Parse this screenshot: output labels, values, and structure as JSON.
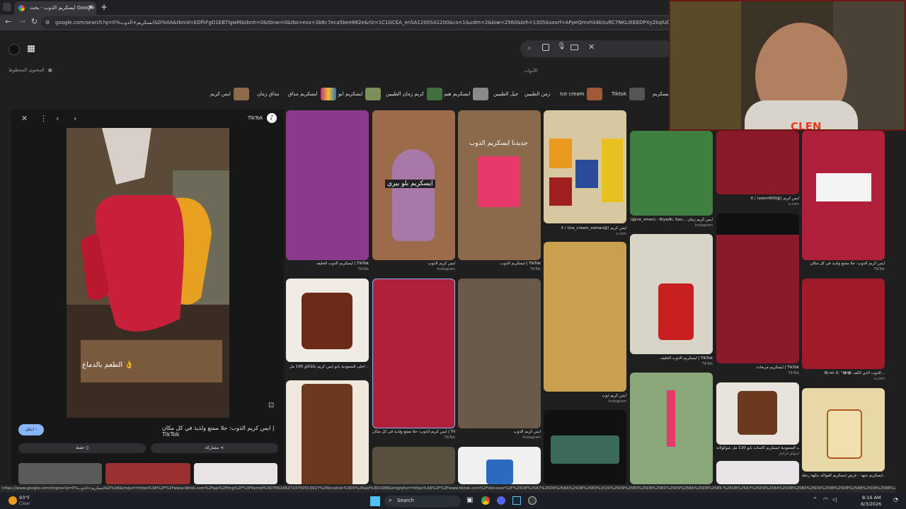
{
  "browser": {
    "tab_title": "ايسكريم الذوب - بحث Google",
    "new_tab": "+",
    "url": "google.com/search?q=0%ايسكريم+الذوب&D%0A&tbnid=EDfhFgD1EBTlgwM&tbnh=0&tbnw=0&tbs=esv=3b8c7eca5bee662e&rlz=1C1GCEA_enSA1200SA1200&cs=1&udm=2&biw=2560&bih=1305&sxsrf=APpeQmvhS4bSuRC7NKL0tEEDPXy2kqIUOA%3A1785708681796&ei=icBvatO"
  },
  "google": {
    "safe_search": "المحتوى المحظوظ",
    "tools": "الأدوات"
  },
  "chips": [
    {
      "label": "ايس كريم",
      "color": "#8c6a4a"
    },
    {
      "label": "مذاق زمان",
      "color": "#b94a4a"
    },
    {
      "label": "ايسكريم مذاق",
      "color": "#c0307a"
    },
    {
      "label": "ايسكريم ابو",
      "color": "#7a8f5a"
    },
    {
      "label": "كريم زمان الطيبين",
      "color": "#3f6f3f"
    },
    {
      "label": "ايسكريم هيم",
      "color": "#8a8a8a"
    },
    {
      "label": "جيل الطيبين",
      "color": ""
    },
    {
      "label": "زمن الطيبين",
      "color": ""
    },
    {
      "label": "Ice cream",
      "color": "#a05a3a"
    },
    {
      "label": "Tiktok",
      "color": "#555555"
    },
    {
      "label": "ايسكريم",
      "color": "#4a4a7a"
    }
  ],
  "preview": {
    "source": "TikTok",
    "overlay_text": "الطعم بالدماغ 👌",
    "title": "ايس كريم الذوب: حلا ممتع ولذيذ في كل مكان | TikTok",
    "visit": "انتقل",
    "save": "حفظ",
    "share": "مشاركة"
  },
  "results": [
    {
      "caption": "ايسكريم الذوب الخليف | TikTok",
      "source": "TikTok",
      "color": "#8b3a8b"
    },
    {
      "caption": "ايس كريم الذوب",
      "source": "Instagram",
      "color": "#9b6b4a",
      "overlay": "ايسكريم بلو بيري"
    },
    {
      "caption": "ايسكريم الذوب | TikTok",
      "source": "TikTok",
      "color": "#8a6a4a",
      "overlay": "جديدنا ايسكريم الذوب"
    },
    {
      "caption": "X / (ice_cream_zaman@) ايس كريم",
      "source": "x.com",
      "color": "#d8c8a0"
    },
    {
      "caption": "(@ice_zman) - Riyadh, Sau... ايس كريم زمان",
      "source": "Instagram",
      "color": "#3f7f3f"
    },
    {
      "caption": "X / (askm600@) ايس كريم",
      "source": "x.com",
      "color": "#8a1a2a"
    },
    {
      "caption": "ايس كريم الذوب: حلا ممتع ولذيذ في كل مكان",
      "source": "TikTok",
      "color": "#b0203a"
    },
    {
      "caption": "أحلى السعودية بابو آيس كريم بالكاكاو 100 مل ..",
      "source": "",
      "color": "#f0ece4"
    },
    {
      "caption": "ايس كريم الذوب: حلا ممتع ولذيذ في كل مكان | TikTok",
      "source": "TikTok",
      "color": "#b0203a"
    },
    {
      "caption": "ايس كريم الذوب",
      "source": "Instagram",
      "color": "#6a5a4a"
    },
    {
      "caption": "ايس كريم ذوب",
      "source": "Instagram",
      "color": "#c8a050"
    },
    {
      "caption": "ايسكريم الذوب الخليف | TikTok",
      "source": "TikTok",
      "color": "#d8d4c8"
    },
    {
      "caption": "ايسكريم مربعات | TikTok",
      "source": "TikTok",
      "color": "#8a1a2a"
    },
    {
      "caption": "Nj on X: \"😂😂 الذوب الذي الكف...",
      "source": "x.com",
      "color": "#a01a2a"
    },
    {
      "caption": "الذوب السعودية ايسكريم كاسات بابو 120 مل شوكولاته",
      "source": "أسواق الزاجل",
      "color": "#e8e4dc"
    },
    {
      "caption": "ايسكريم شهد - عرض ايسكريم الفواكه بنكهة رحلة...",
      "source": "",
      "color": "#e8d8a8"
    }
  ],
  "status_bar_url": "https://www.google.com/imgres?q=0%ايسكريم+الذوب&D%0A&imgurl=https%3A%2F%2Fwww.tiktok.com%2Fapi%2Fimg%2F%3FitemId%3D7661662723750513927%26location%3D0%26aid%3D1988&imgrefurl=https%3A%2F%2Fwww.tiktok.com%2Fdiscover%2F%25D8%25A7%25D9%258A%25D8%25B3%2520%25D9%2583%25D8%25B1%25D9%258A%25D9%2585-%25D8%25A7%25D9%2584%25D8%25B0%25D9%2588%25D8%25A8%25D9%2588%25D8%25A8%25D8%25A7%25D9%2584",
  "taskbar": {
    "weather_temp": "93°F",
    "weather_desc": "Clear",
    "search": "Search",
    "time": "8:16 AM",
    "date": "8/3/2026"
  },
  "webcam": {
    "overlay": "CLEN"
  }
}
